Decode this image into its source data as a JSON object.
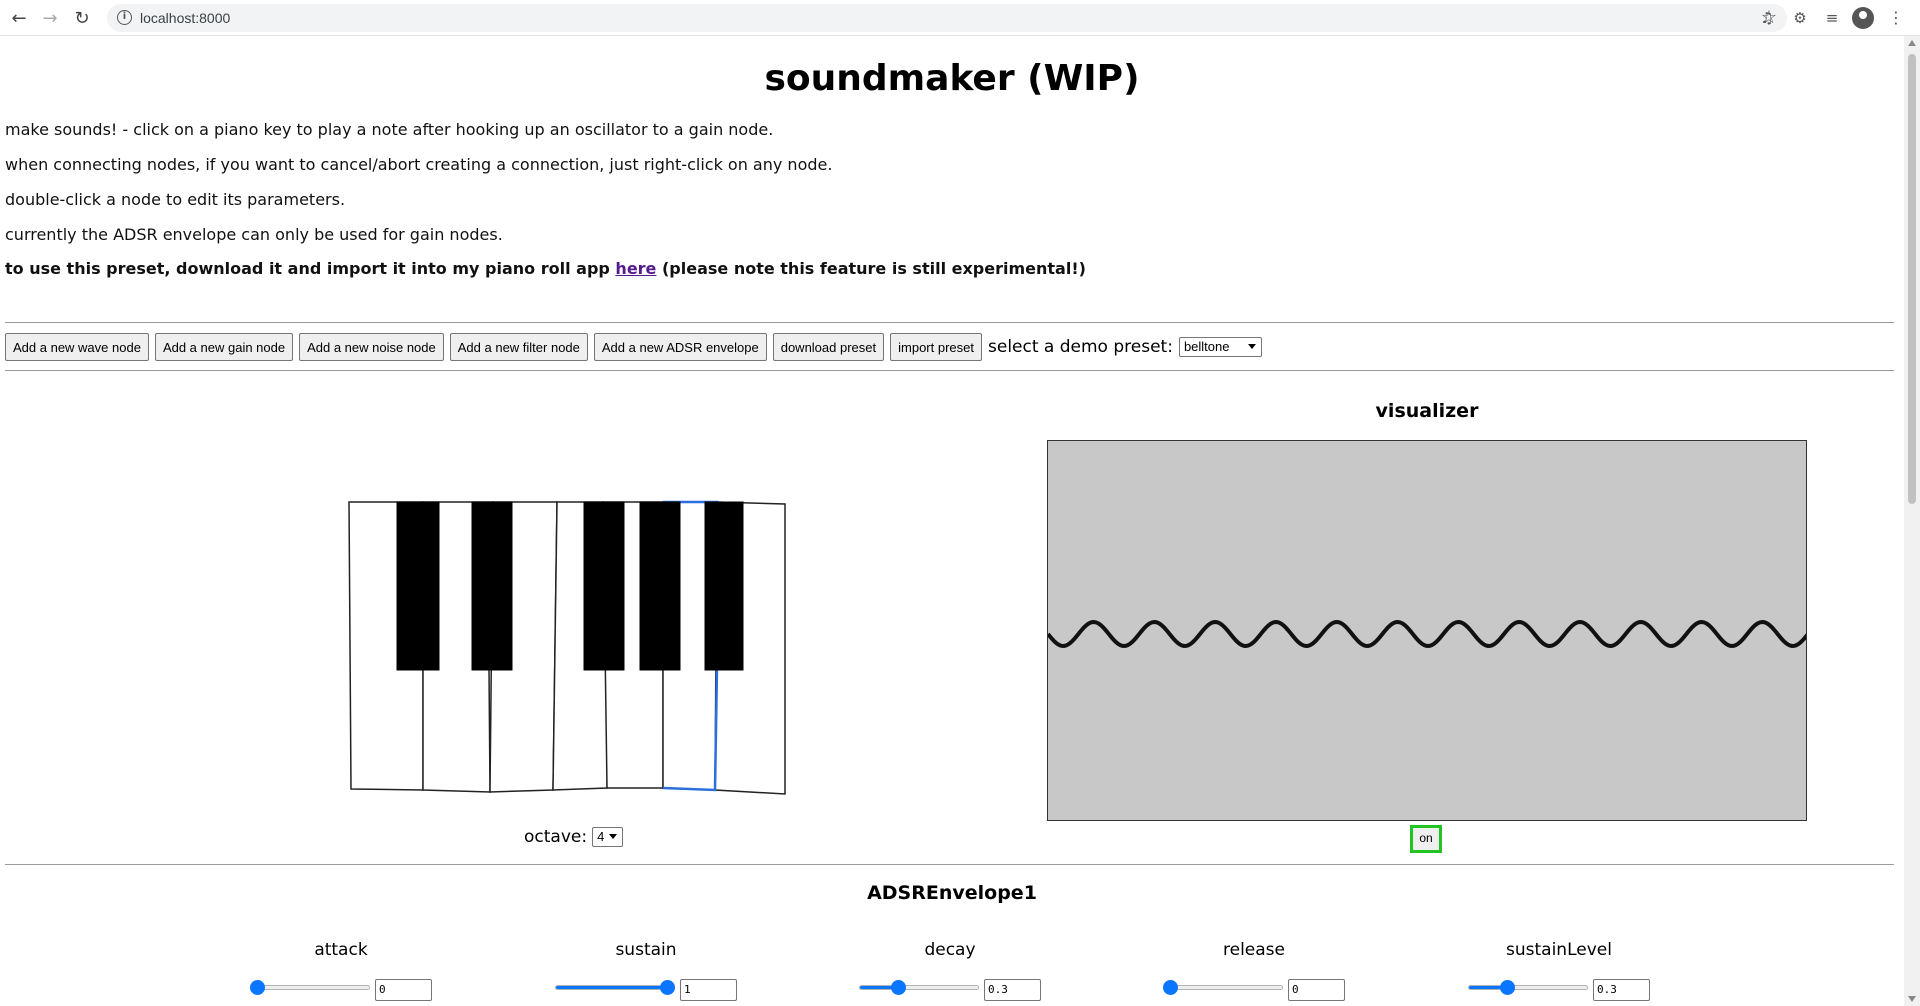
{
  "browser": {
    "url": "localhost:8000"
  },
  "page": {
    "title": "soundmaker (WIP)",
    "instructions": [
      "make sounds! - click on a piano key to play a note after hooking up an oscillator to a gain node.",
      "when connecting nodes, if you want to cancel/abort creating a connection, just right-click on any node.",
      "double-click a node to edit its parameters.",
      "currently the ADSR envelope can only be used for gain nodes."
    ],
    "preset_note": {
      "before": "to use this preset, download it and import it into my piano roll app ",
      "link": "here",
      "after": " (please note this feature is still experimental!)"
    }
  },
  "toolbar": {
    "buttons": [
      "Add a new wave node",
      "Add a new gain node",
      "Add a new noise node",
      "Add a new filter node",
      "Add a new ADSR envelope",
      "download preset",
      "import preset"
    ],
    "demo_preset_label": "select a demo preset:",
    "demo_preset_value": "belltone"
  },
  "piano": {
    "octave_label": "octave:",
    "octave_value": "4",
    "selected_key": "B",
    "highlight_color": "#2a6fdb"
  },
  "visualizer": {
    "title": "visualizer",
    "toggle_label": "on",
    "toggle_color": "#22c322",
    "background": "#c8c8c8",
    "wave_cycles": 12.5
  },
  "adsr": {
    "title": "ADSREnvelope1",
    "params": [
      {
        "label": "attack",
        "value": "0",
        "fraction": 0
      },
      {
        "label": "sustain",
        "value": "1",
        "fraction": 1
      },
      {
        "label": "decay",
        "value": "0.3",
        "fraction": 0.3
      },
      {
        "label": "release",
        "value": "0",
        "fraction": 0
      },
      {
        "label": "sustainLevel",
        "value": "0.3",
        "fraction": 0.3
      }
    ]
  }
}
